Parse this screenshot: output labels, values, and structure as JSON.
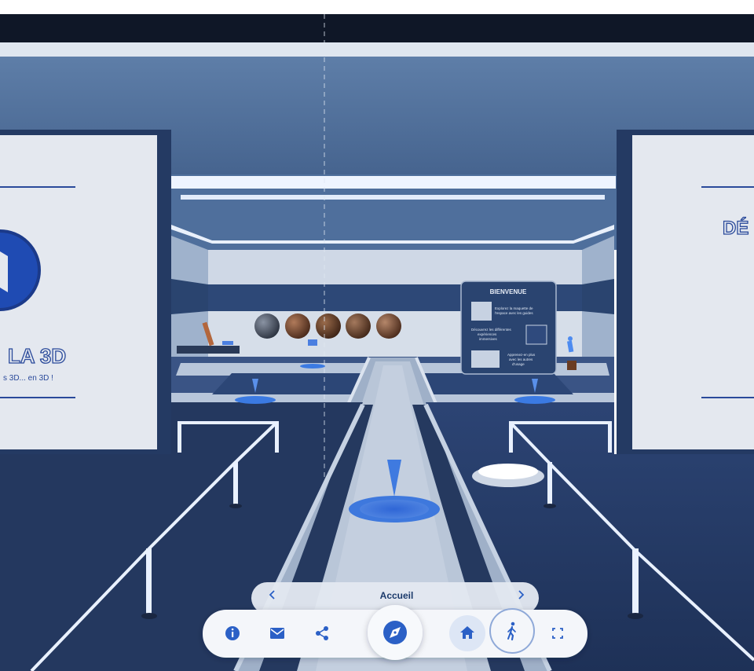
{
  "scene": {
    "left_panel": {
      "title": "LA 3D",
      "subtitle": "s 3D... en 3D !"
    },
    "right_panel": {
      "title": "DÉ"
    },
    "welcome_board": {
      "title": "BIENVENUE",
      "items": [
        {
          "text_lines": [
            "Explorez la maquette de",
            "l'espace avec les guides"
          ]
        },
        {
          "text_lines": [
            "Découvrez les différentes",
            "expériences",
            "immersives"
          ]
        },
        {
          "text_lines": [
            "Apprenez-en plus",
            "avec les autres",
            "d'usage"
          ]
        }
      ]
    }
  },
  "toolbar": {
    "location_label": "Accueil",
    "prev_icon": "chevron-left-icon",
    "next_icon": "chevron-right-icon",
    "buttons": [
      {
        "icon": "info-icon"
      },
      {
        "icon": "mail-icon"
      },
      {
        "icon": "share-icon"
      },
      {
        "icon": "compass-icon"
      },
      {
        "icon": "home-icon",
        "active": true
      },
      {
        "icon": "walk-icon",
        "active": true
      },
      {
        "icon": "fullscreen-icon"
      }
    ]
  },
  "colors": {
    "floor_navy": "#23375f",
    "wall_light": "#dfe5ee",
    "accent_blue": "#2f5fd0",
    "toolbar_bg": "#f4f6fa",
    "icon_blue": "#2b60c6"
  }
}
